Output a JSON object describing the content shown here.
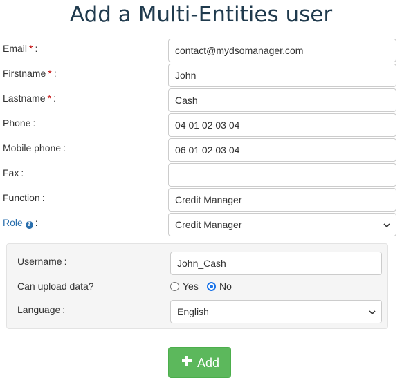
{
  "page": {
    "title": "Add a Multi-Entities user"
  },
  "form": {
    "email": {
      "label": "Email",
      "required_mark": "*",
      "value": "contact@mydsomanager.com"
    },
    "firstname": {
      "label": "Firstname",
      "required_mark": "*",
      "value": "John"
    },
    "lastname": {
      "label": "Lastname",
      "required_mark": "*",
      "value": "Cash"
    },
    "phone": {
      "label": "Phone",
      "value": "04 01 02 03 04"
    },
    "mobile_phone": {
      "label": "Mobile phone",
      "value": "06 01 02 03 04"
    },
    "fax": {
      "label": "Fax",
      "value": ""
    },
    "function": {
      "label": "Function",
      "value": "Credit Manager"
    },
    "role": {
      "label": "Role",
      "help_icon": "question-circle-icon",
      "selected": "Credit Manager"
    },
    "colon": ":"
  },
  "account_panel": {
    "username": {
      "label": "Username",
      "value": "John_Cash"
    },
    "can_upload": {
      "label": "Can upload data?",
      "options": [
        "Yes",
        "No"
      ],
      "selected": "No"
    },
    "language": {
      "label": "Language",
      "selected": "English"
    }
  },
  "actions": {
    "add_label": "Add",
    "add_icon": "plus-icon"
  },
  "colors": {
    "title": "#1f3a4d",
    "link": "#2a6fad",
    "required": "#c00000",
    "button": "#5cb85c",
    "radio_active": "#1a73e8"
  }
}
